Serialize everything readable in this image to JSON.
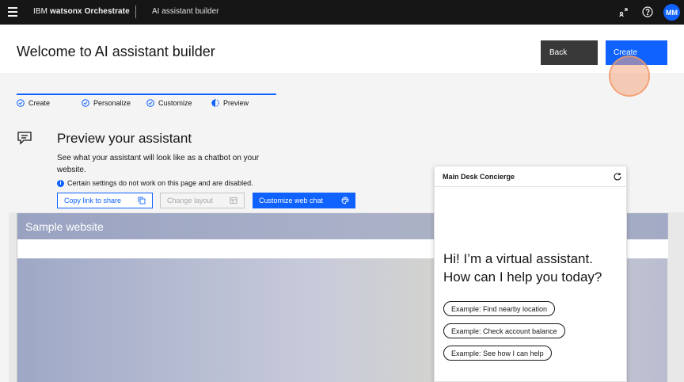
{
  "topbar": {
    "brand_prefix": "IBM",
    "brand_product": "watsonx Orchestrate",
    "page_name": "AI assistant builder",
    "avatar_initials": "MM",
    "icons": [
      "menu-icon",
      "switcher-icon",
      "help-icon"
    ]
  },
  "header": {
    "title": "Welcome to AI assistant builder",
    "back_label": "Back",
    "create_label": "Create"
  },
  "progress": {
    "steps": [
      {
        "label": "Create",
        "state": "complete"
      },
      {
        "label": "Personalize",
        "state": "complete"
      },
      {
        "label": "Customize",
        "state": "complete"
      },
      {
        "label": "Preview",
        "state": "current"
      }
    ]
  },
  "preview": {
    "title": "Preview your assistant",
    "description": "See what your assistant will look like as a chatbot on your website.",
    "note": "Certain settings do not work on this page and are disabled.",
    "copy_link_label": "Copy link to share",
    "change_layout_label": "Change layout",
    "customize_label": "Customize web chat"
  },
  "sample_site": {
    "title": "Sample website"
  },
  "chat": {
    "assistant_name": "Main Desk Concierge",
    "greeting": "Hi! I’m a virtual assistant. How can I help you today?",
    "examples": [
      "Example: Find nearby location",
      "Example: Check account balance",
      "Example: See how I can help"
    ]
  },
  "colors": {
    "accent": "#0f62fe",
    "topbar": "#161616",
    "back_button": "#393939"
  }
}
